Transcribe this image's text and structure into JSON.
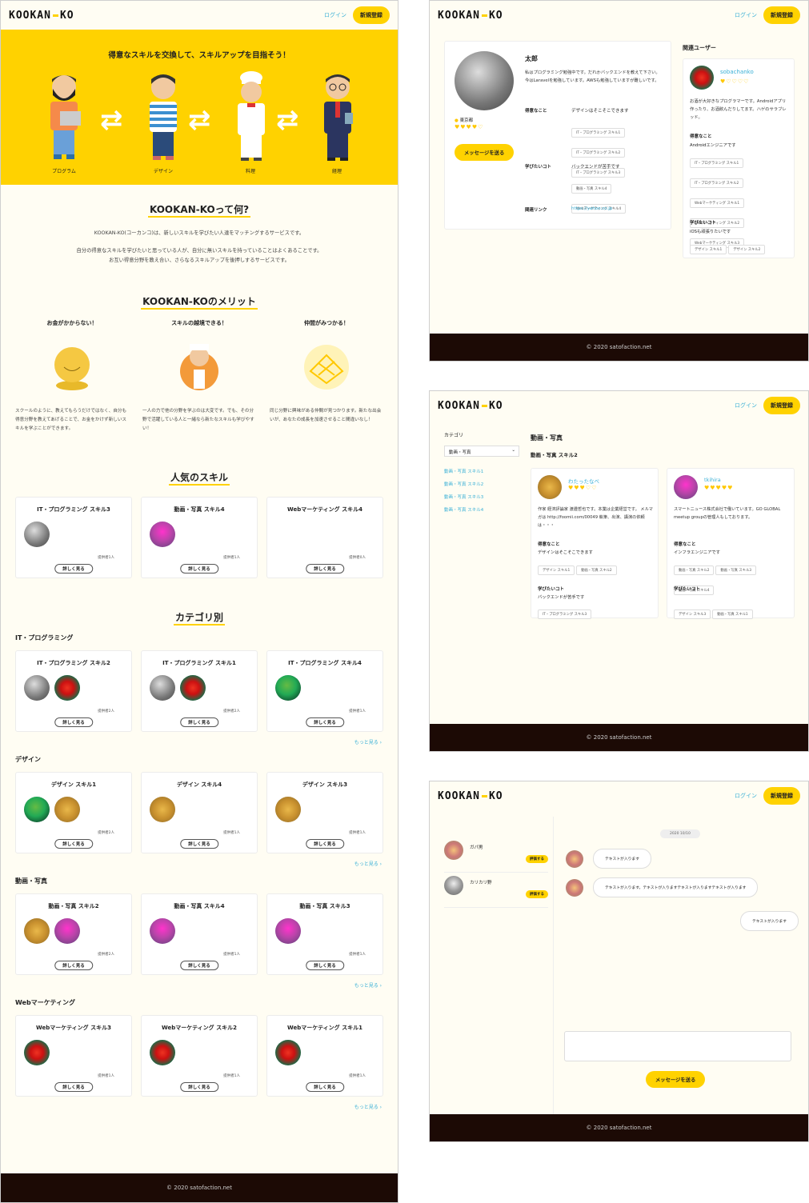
{
  "brand": {
    "logo_left": "KOOKAN",
    "logo_right": "KO",
    "login": "ログイン",
    "signup": "新規登録",
    "footer": "© 2020 satofaction.net"
  },
  "colors": {
    "accent": "#ffd200",
    "link": "#3ab0d6",
    "footer": "#1c0a05",
    "background": "#fffdf3"
  },
  "hero": {
    "title": "得意なスキルを交換して、スキルアップを目指そう！",
    "labels": [
      "プログラム",
      "デザイン",
      "料理",
      "経理"
    ]
  },
  "about": {
    "title": "KOOKAN-KOって何?",
    "lines": [
      "KOOKAN-KO(コーカンコ)は、新しいスキルを学びたい人達をマッチングするサービスです。",
      "自分の得意なスキルを学びたいと思っている人が、自分に無いスキルを持っていることはよくあることです。",
      "お互い得意分野を教え合い、さらなるスキルアップを後押しするサービスです。"
    ]
  },
  "merits": {
    "title": "KOOKAN-KOのメリット",
    "items": [
      {
        "title": "お金がかからない！",
        "text": "スクールのように、教えてもらうだけではなく、自分も得意分野を教えてあげることで、お金をかけず新しいスキルを学ぶことができます。"
      },
      {
        "title": "スキルの越境できる！",
        "text": "一人の力で他の分野を学ぶのは大変です。でも、その分野で活躍している人と一緒なら新たなスキルも学びやすい！"
      },
      {
        "title": "仲間がみつかる！",
        "text": "同じ分野に興味がある仲間が見つかります。新たな出会いが、あなたの成長を加速させること間違いなし！"
      }
    ]
  },
  "popular": {
    "title": "人気のスキル",
    "cards": [
      {
        "name": "IT・プログラミング スキル3",
        "count": "提供者1人",
        "avatars": [
          "gray"
        ]
      },
      {
        "name": "動画・写真 スキル4",
        "count": "提供者1人",
        "avatars": [
          "purple"
        ]
      },
      {
        "name": "Webマーケティング スキル4",
        "count": "提供者0人",
        "avatars": []
      }
    ]
  },
  "more_label": "詳しく見る",
  "see_more": "もっと見る ›",
  "categories": {
    "title": "カテゴリ別",
    "groups": [
      {
        "label": "IT・プログラミング",
        "cards": [
          {
            "name": "IT・プログラミング スキル2",
            "count": "提供者2人",
            "avatars": [
              "gray",
              "red"
            ]
          },
          {
            "name": "IT・プログラミング スキル1",
            "count": "提供者2人",
            "avatars": [
              "gray",
              "red"
            ]
          },
          {
            "name": "IT・プログラミング スキル4",
            "count": "提供者1人",
            "avatars": [
              "green"
            ]
          }
        ]
      },
      {
        "label": "デザイン",
        "cards": [
          {
            "name": "デザイン スキル1",
            "count": "提供者2人",
            "avatars": [
              "green",
              "orange"
            ]
          },
          {
            "name": "デザイン スキル4",
            "count": "提供者1人",
            "avatars": [
              "orange"
            ]
          },
          {
            "name": "デザイン スキル3",
            "count": "提供者1人",
            "avatars": [
              "orange"
            ]
          }
        ]
      },
      {
        "label": "動画・写真",
        "cards": [
          {
            "name": "動画・写真 スキル2",
            "count": "提供者2人",
            "avatars": [
              "orange",
              "purple"
            ]
          },
          {
            "name": "動画・写真 スキル4",
            "count": "提供者1人",
            "avatars": [
              "purple"
            ]
          },
          {
            "name": "動画・写真 スキル3",
            "count": "提供者1人",
            "avatars": [
              "purple"
            ]
          }
        ]
      },
      {
        "label": "Webマーケティング",
        "cards": [
          {
            "name": "Webマーケティング スキル3",
            "count": "提供者1人",
            "avatars": [
              "red"
            ]
          },
          {
            "name": "Webマーケティング スキル2",
            "count": "提供者1人",
            "avatars": [
              "red"
            ]
          },
          {
            "name": "Webマーケティング スキル1",
            "count": "提供者1人",
            "avatars": [
              "red"
            ]
          }
        ]
      }
    ]
  },
  "profile": {
    "name": "太郎",
    "location": "東京都",
    "rating": 4,
    "intro": "私はプログラミング勉強中です。だれかバックエンドを教えて下さい。今はLaravelを勉強しています。AWSも勉強していますが難しいです。",
    "message_btn": "メッセージを送る",
    "strong_label": "得意なこと",
    "strong_text": "デザインはそこそこできます",
    "strong_tags": [
      "IT・プログラミング スキル1",
      "IT・プログラミング スキル2",
      "IT・プログラミング スキル3"
    ],
    "learn_label": "学びたいコト",
    "learn_text": "バックエンドが苦手です",
    "learn_tags": [
      "動画・写真 スキル4",
      "Webマーケティング スキル4"
    ],
    "link_label": "関連リンク",
    "link": "https://yahoo.co.jp"
  },
  "related": {
    "title": "関連ユーザー",
    "name": "sobachanko",
    "rating": 1,
    "intro": "お酒が大好きなプログラマーです。Androidアプリ作ったり、お酒飲んだりしてます。ハゲのサラブレッド。",
    "strong_label": "得意なこと",
    "strong_text": "Androidエンジニアです",
    "strong_tags": [
      "IT・プログラミング スキル1",
      "IT・プログラミング スキル2",
      "Webマーケティング スキル1",
      "Webマーケティング スキル2",
      "Webマーケティング スキル3"
    ],
    "learn_label": "学びたいコト",
    "learn_text": "iOSも頑張りたいです",
    "learn_tags": [
      "デザイン スキル1",
      "デザイン スキル2"
    ]
  },
  "category_page": {
    "side_label": "カテゴリ",
    "select": "動画・写真",
    "links": [
      "動画・写真 スキル1",
      "動画・写真 スキル2",
      "動画・写真 スキル3",
      "動画・写真 スキル4"
    ],
    "heading": "動画・写真",
    "subheading": "動画・写真 スキル2",
    "users": [
      {
        "name": "わたったなべ",
        "rating": 3,
        "intro": "作家 経済評論家 渡邉哲也です。本業は企業経営です。 メルマガは http://foomii.com/00049 執筆、出演、講演の依頼は・・・",
        "strong_text": "デザインはそこそこできます",
        "strong_tags": [
          "デザイン スキル1",
          "動画・写真 スキル2"
        ],
        "learn_text": "バックエンドが苦手です",
        "learn_tags": [
          "IT・プログラミング スキル3"
        ],
        "avatar": "orange"
      },
      {
        "name": "tkihira",
        "rating": 5,
        "intro": "スマートニュース株式会社で働いています。GO GLOBAL meetup groupの管理人もしております。",
        "strong_text": "インフラエンジニアです",
        "strong_tags": [
          "動画・写真 スキル2",
          "動画・写真 スキル3",
          "動画・写真 スキル4"
        ],
        "learn_text": "",
        "learn_tags": [
          "デザイン スキル3",
          "動画・写真 スキル1"
        ],
        "avatar": "purple"
      }
    ],
    "strong_label": "得意なこと",
    "learn_label": "学びたいコト"
  },
  "chat": {
    "users": [
      {
        "name": "ガパ男",
        "btn": "評価する"
      },
      {
        "name": "カリカリ野",
        "btn": "評価する"
      }
    ],
    "date": "2020 10/10",
    "messages": [
      {
        "text": "テキストが入ります",
        "side": "left"
      },
      {
        "text": "テキストが入ります。テキストが入りますテキストが入りますテキストが入ります",
        "side": "left"
      },
      {
        "text": "テキストが入ります",
        "side": "right"
      }
    ],
    "send": "メッセージを送る"
  }
}
